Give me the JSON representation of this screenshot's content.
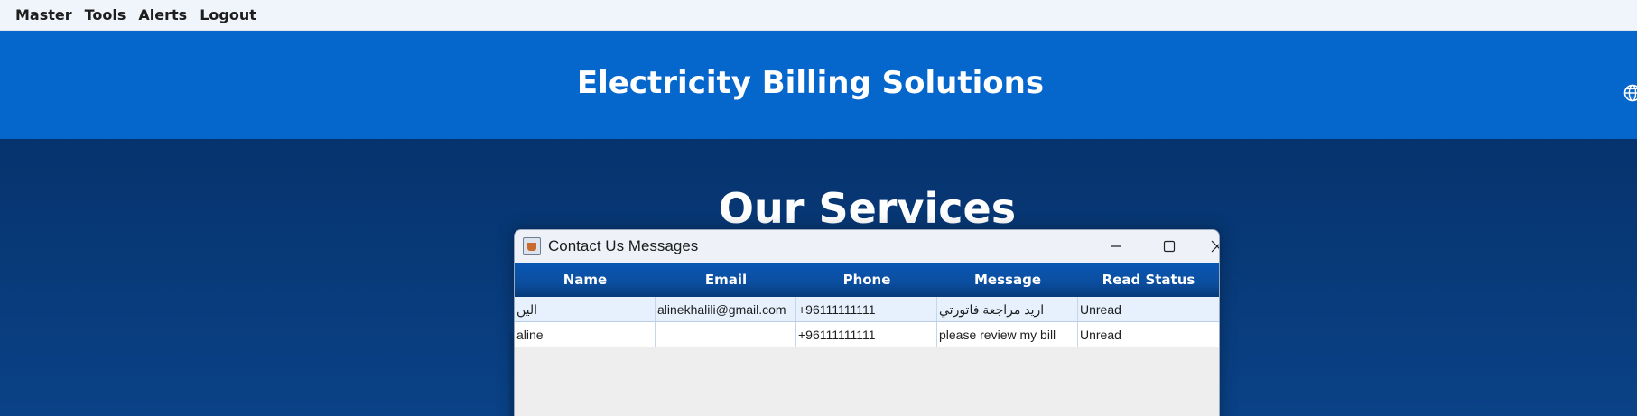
{
  "menubar": {
    "items": [
      {
        "label": "Master"
      },
      {
        "label": "Tools"
      },
      {
        "label": "Alerts"
      },
      {
        "label": "Logout"
      }
    ]
  },
  "header": {
    "title": "Electricity Billing Solutions",
    "language_icon": "globe-icon"
  },
  "hero": {
    "title": "Our Services"
  },
  "dialog": {
    "title": "Contact Us Messages",
    "icon": "java-app-icon",
    "controls": [
      "minimize-icon",
      "maximize-icon",
      "close-icon"
    ],
    "table": {
      "columns": [
        "Name",
        "Email",
        "Phone",
        "Message",
        "Read Status"
      ],
      "rows": [
        {
          "name": "الين",
          "email": "alinekhalili@gmail.com",
          "phone": "+96111111111",
          "message": "اريد مراجعة فاتورتي",
          "status": "Unread"
        },
        {
          "name": "aline",
          "email": "",
          "phone": "+96111111111",
          "message": "please review my bill",
          "status": "Unread"
        }
      ]
    }
  },
  "colors": {
    "menubar_bg": "#f0f4fb",
    "header_bg": "#0566cc",
    "hero_bg": "#06336d",
    "table_header_bg": "#0a57b4",
    "row_alt_bg": "#e6f1fd"
  }
}
